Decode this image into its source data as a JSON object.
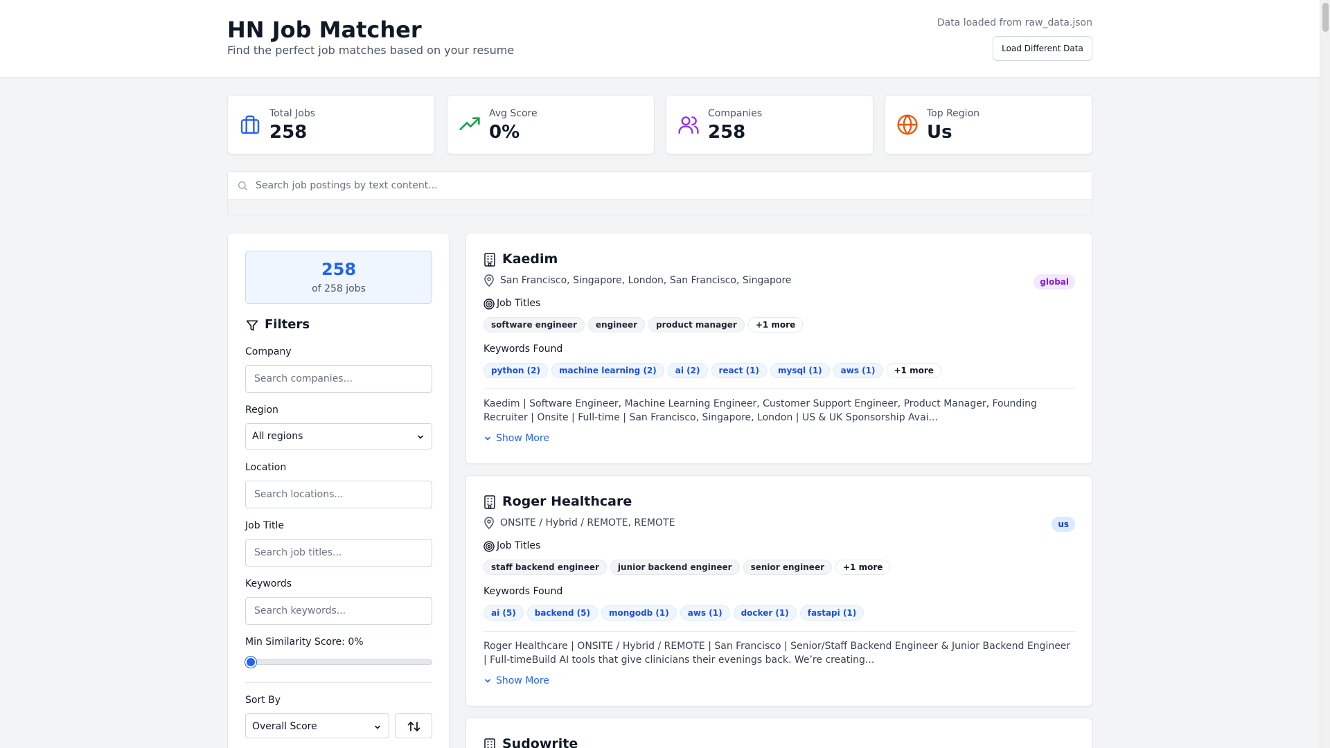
{
  "header": {
    "title": "HN Job Matcher",
    "subtitle": "Find the perfect job matches based on your resume",
    "data_source": "Data loaded from raw_data.json",
    "load_button": "Load Different Data"
  },
  "stats": [
    {
      "label": "Total Jobs",
      "value": "258",
      "icon": "briefcase-icon",
      "color": "#2563eb"
    },
    {
      "label": "Avg Score",
      "value": "0%",
      "icon": "trending-up-icon",
      "color": "#16a34a"
    },
    {
      "label": "Companies",
      "value": "258",
      "icon": "users-icon",
      "color": "#9333ea"
    },
    {
      "label": "Top Region",
      "value": "Us",
      "icon": "globe-icon",
      "color": "#ea580c"
    }
  ],
  "search": {
    "placeholder": "Search job postings by text content...",
    "value": ""
  },
  "sidebar": {
    "count": "258",
    "count_of": "of 258 jobs",
    "filters_title": "Filters",
    "company": {
      "label": "Company",
      "placeholder": "Search companies..."
    },
    "region": {
      "label": "Region",
      "value": "All regions"
    },
    "location": {
      "label": "Location",
      "placeholder": "Search locations..."
    },
    "job_title": {
      "label": "Job Title",
      "placeholder": "Search job titles..."
    },
    "keywords": {
      "label": "Keywords",
      "placeholder": "Search keywords..."
    },
    "min_score": {
      "label": "Min Similarity Score: 0%",
      "value": 0
    },
    "sort": {
      "label": "Sort By",
      "value": "Overall Score",
      "direction_icon": "sort-direction-icon"
    }
  },
  "jobs": [
    {
      "company": "Kaedim",
      "location": "San Francisco, Singapore, London, San Francisco, Singapore",
      "region": "global",
      "job_titles_label": "Job Titles",
      "job_titles": [
        "software engineer",
        "engineer",
        "product manager"
      ],
      "job_titles_more": "+1 more",
      "keywords_label": "Keywords Found",
      "keywords": [
        "python (2)",
        "machine learning (2)",
        "ai (2)",
        "react (1)",
        "mysql (1)",
        "aws (1)"
      ],
      "keywords_more": "+1 more",
      "description": "Kaedim | Software Engineer, Machine Learning Engineer, Customer Support Engineer, Product Manager, Founding Recruiter | Onsite | Full-time | San Francisco, Singapore, London | US & UK Sponsorship Avai...",
      "show_more": "Show More"
    },
    {
      "company": "Roger Healthcare",
      "location": "ONSITE / Hybrid / REMOTE, REMOTE",
      "region": "us",
      "job_titles_label": "Job Titles",
      "job_titles": [
        "staff backend engineer",
        "junior backend engineer",
        "senior engineer"
      ],
      "job_titles_more": "+1 more",
      "keywords_label": "Keywords Found",
      "keywords": [
        "ai (5)",
        "backend (5)",
        "mongodb (1)",
        "aws (1)",
        "docker (1)",
        "fastapi (1)"
      ],
      "description": "Roger Healthcare | ONSITE / Hybrid / REMOTE | San Francisco | Senior/Staff Backend Engineer & Junior Backend Engineer | Full-timeBuild AI tools that give clinicians their evenings back. We’re creating...",
      "show_more": "Show More"
    },
    {
      "company": "Sudowrite"
    }
  ],
  "colors": {
    "accent": "#2563eb",
    "region_global_bg": "#f3e8ff",
    "region_global_fg": "#7e22ce",
    "region_us_bg": "#dbeafe",
    "region_us_fg": "#1e40af"
  }
}
